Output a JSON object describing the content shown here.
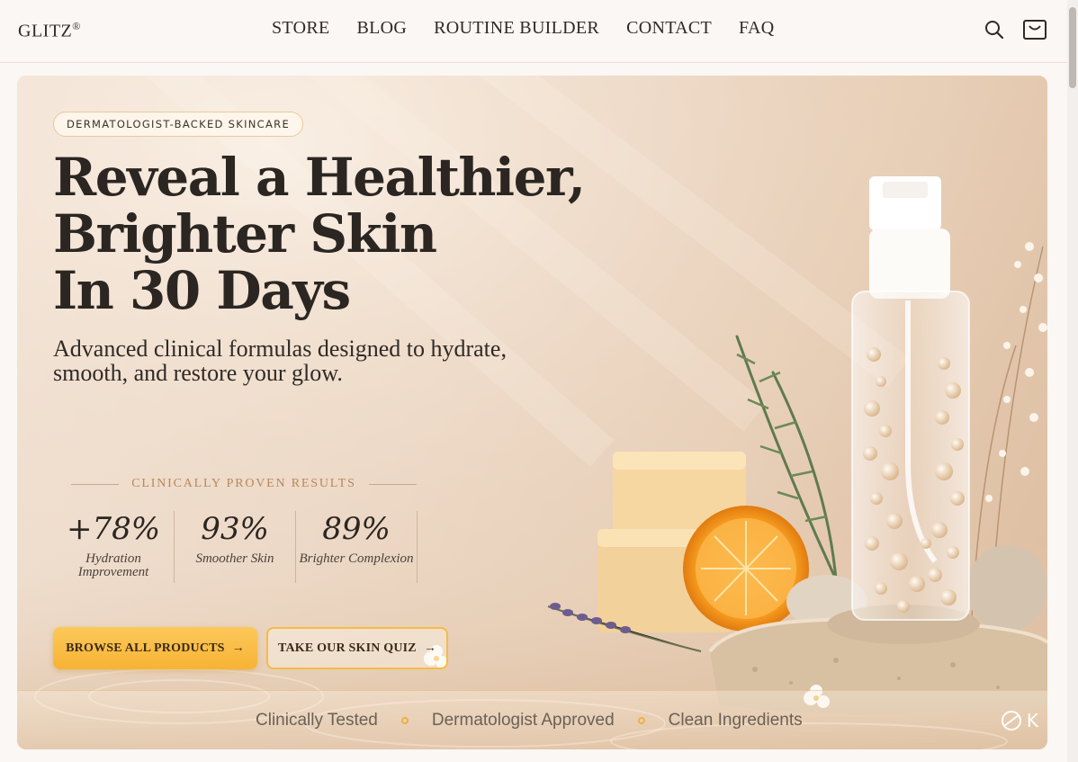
{
  "header": {
    "logo": "GLITZ",
    "logo_mark": "®",
    "nav": [
      "STORE",
      "BLOG",
      "ROUTINE BUILDER",
      "CONTACT",
      "FAQ"
    ],
    "icons": [
      "search-icon",
      "cart-icon"
    ]
  },
  "hero": {
    "badge": "DERMATOLOGIST-BACKED SKINCARE",
    "headline": [
      "Reveal a Healthier,",
      "Brighter Skin",
      "In 30 Days"
    ],
    "subhead": "Advanced clinical formulas designed to hydrate, smooth, and restore your glow.",
    "proven_label": "CLINICALLY PROVEN RESULTS",
    "stats": [
      {
        "value": "+78%",
        "label": "Hydration Improvement"
      },
      {
        "value": "93%",
        "label": "Smoother Skin"
      },
      {
        "value": "89%",
        "label": "Brighter Complexion"
      }
    ],
    "buttons": {
      "primary": "BROWSE ALL PRODUCTS",
      "secondary": "TAKE OUR SKIN QUIZ",
      "arrow": "→"
    },
    "trust": [
      "Clinically Tested",
      "Dermatologist Approved",
      "Clean Ingredients"
    ],
    "corner_mark": "K"
  },
  "colors": {
    "accent": "#f7b334",
    "text": "#2f2a26",
    "gold": "#b8875a"
  }
}
